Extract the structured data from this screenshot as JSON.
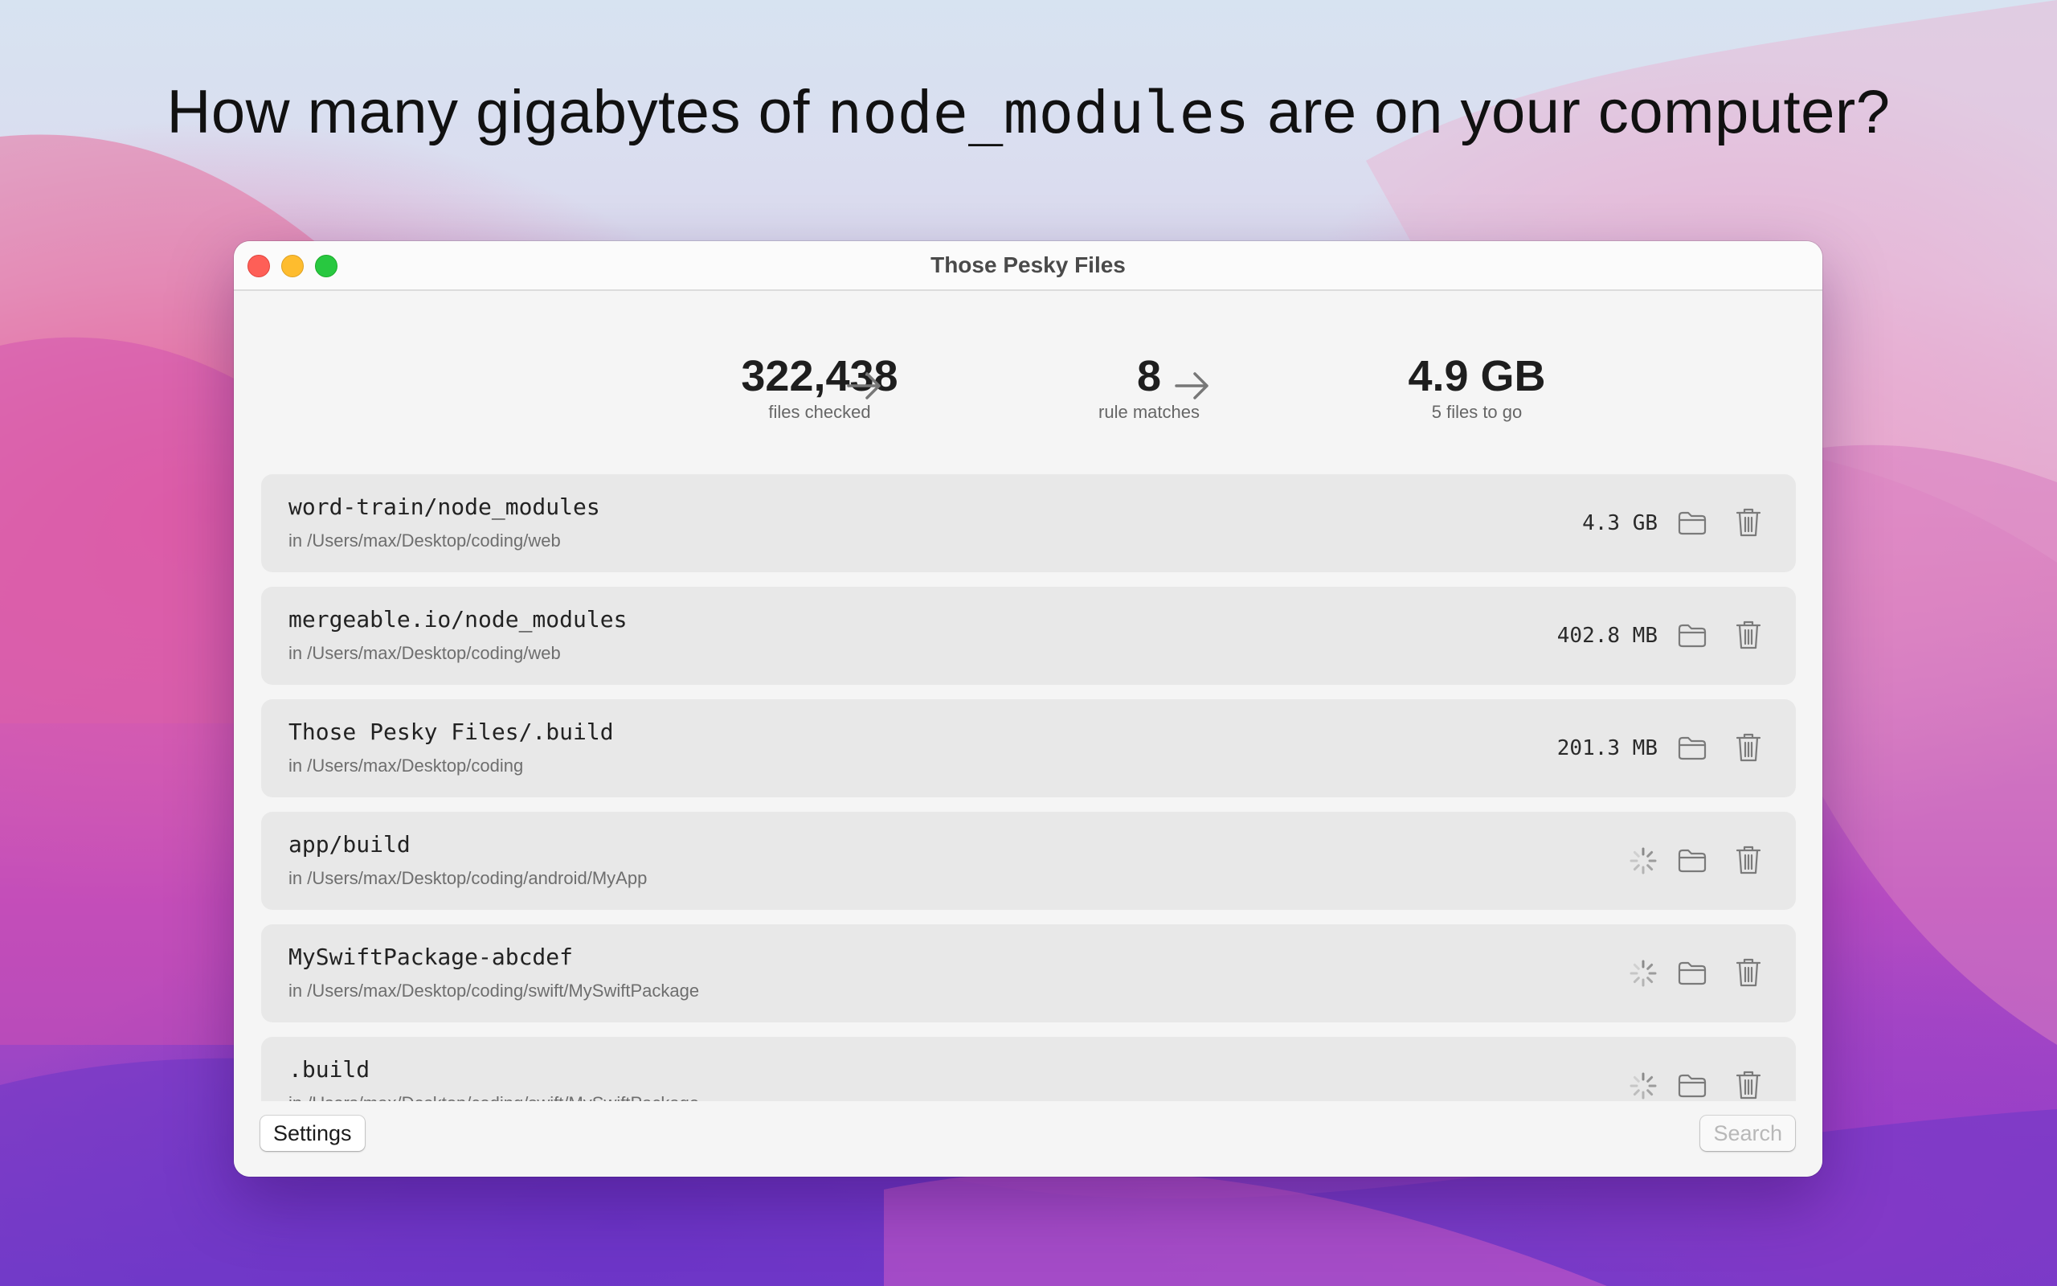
{
  "headline": {
    "before": "How many gigabytes of ",
    "code": "node_modules",
    "after": " are on your computer?"
  },
  "window": {
    "title": "Those Pesky Files"
  },
  "stats": [
    {
      "value": "322,438",
      "label": "files checked"
    },
    {
      "value": "8",
      "label": "rule matches"
    },
    {
      "value": "4.9 GB",
      "label": "5 files to go"
    }
  ],
  "rows": [
    {
      "name": "word-train/node_modules",
      "path": "in /Users/max/Desktop/coding/web",
      "size": "4.3 GB"
    },
    {
      "name": "mergeable.io/node_modules",
      "path": "in /Users/max/Desktop/coding/web",
      "size": "402.8 MB"
    },
    {
      "name": "Those Pesky Files/.build",
      "path": "in /Users/max/Desktop/coding",
      "size": "201.3 MB"
    },
    {
      "name": "app/build",
      "path": "in /Users/max/Desktop/coding/android/MyApp",
      "size": ""
    },
    {
      "name": "MySwiftPackage-abcdef",
      "path": "in /Users/max/Desktop/coding/swift/MySwiftPackage",
      "size": ""
    },
    {
      "name": ".build",
      "path": "in /Users/max/Desktop/coding/swift/MySwiftPackage",
      "size": ""
    }
  ],
  "icons": {
    "arrow": "arrow-right-icon",
    "folder": "folder-icon",
    "trash": "trash-icon",
    "spinner": "spinner-icon"
  },
  "footer": {
    "settings_label": "Settings",
    "search_label": "Search"
  },
  "colors": {
    "close": "#fe5f57",
    "minimize": "#febc2e",
    "maximize": "#28c840"
  }
}
